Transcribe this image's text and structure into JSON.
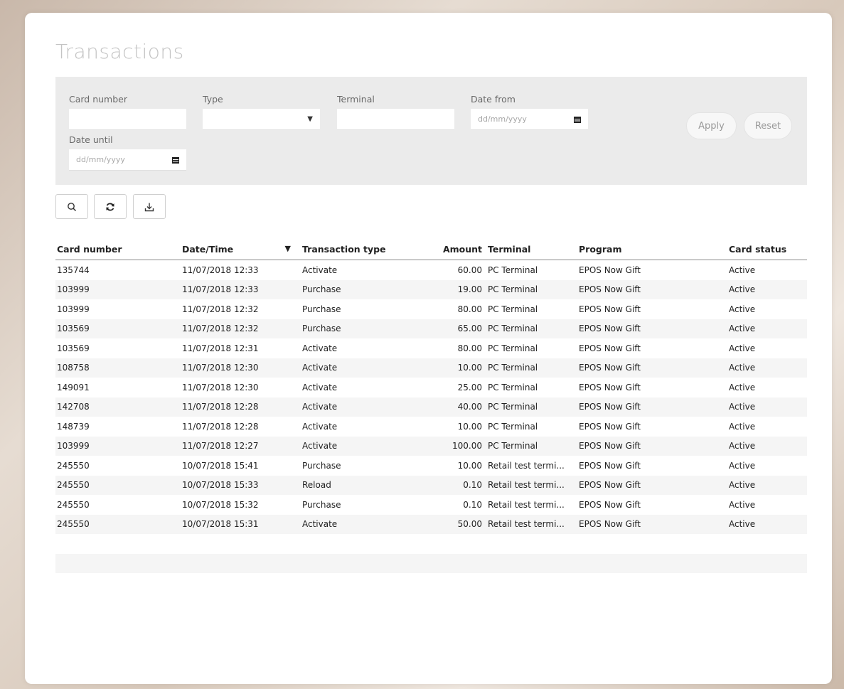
{
  "page": {
    "title": "Transactions"
  },
  "filters": {
    "card_number_label": "Card number",
    "type_label": "Type",
    "terminal_label": "Terminal",
    "date_from_label": "Date from",
    "date_from_placeholder": "dd/mm/yyyy",
    "date_until_label": "Date until",
    "date_until_placeholder": "dd/mm/yyyy",
    "apply_label": "Apply",
    "reset_label": "Reset"
  },
  "table": {
    "columns": [
      "Card number",
      "Date/Time",
      "Transaction type",
      "Amount",
      "Terminal",
      "Program",
      "Card status"
    ],
    "rows": [
      [
        "135744",
        "11/07/2018 12:33",
        "Activate",
        "60.00",
        "PC Terminal",
        "EPOS Now Gift",
        "Active"
      ],
      [
        "103999",
        "11/07/2018 12:33",
        "Purchase",
        "19.00",
        "PC Terminal",
        "EPOS Now Gift",
        "Active"
      ],
      [
        "103999",
        "11/07/2018 12:32",
        "Purchase",
        "80.00",
        "PC Terminal",
        "EPOS Now Gift",
        "Active"
      ],
      [
        "103569",
        "11/07/2018 12:32",
        "Purchase",
        "65.00",
        "PC Terminal",
        "EPOS Now Gift",
        "Active"
      ],
      [
        "103569",
        "11/07/2018 12:31",
        "Activate",
        "80.00",
        "PC Terminal",
        "EPOS Now Gift",
        "Active"
      ],
      [
        "108758",
        "11/07/2018 12:30",
        "Activate",
        "10.00",
        "PC Terminal",
        "EPOS Now Gift",
        "Active"
      ],
      [
        "149091",
        "11/07/2018 12:30",
        "Activate",
        "25.00",
        "PC Terminal",
        "EPOS Now Gift",
        "Active"
      ],
      [
        "142708",
        "11/07/2018 12:28",
        "Activate",
        "40.00",
        "PC Terminal",
        "EPOS Now Gift",
        "Active"
      ],
      [
        "148739",
        "11/07/2018 12:28",
        "Activate",
        "10.00",
        "PC Terminal",
        "EPOS Now Gift",
        "Active"
      ],
      [
        "103999",
        "11/07/2018 12:27",
        "Activate",
        "100.00",
        "PC Terminal",
        "EPOS Now Gift",
        "Active"
      ],
      [
        "245550",
        "10/07/2018 15:41",
        "Purchase",
        "10.00",
        "Retail test termi...",
        "EPOS Now Gift",
        "Active"
      ],
      [
        "245550",
        "10/07/2018 15:33",
        "Reload",
        "0.10",
        "Retail test termi...",
        "EPOS Now Gift",
        "Active"
      ],
      [
        "245550",
        "10/07/2018 15:32",
        "Purchase",
        "0.10",
        "Retail test termi...",
        "EPOS Now Gift",
        "Active"
      ],
      [
        "245550",
        "10/07/2018 15:31",
        "Activate",
        "50.00",
        "Retail test termi...",
        "EPOS Now Gift",
        "Active"
      ]
    ]
  },
  "icons": {
    "search": "search-icon",
    "refresh": "refresh-icon",
    "download": "download-icon",
    "calendar": "calendar-icon",
    "select": "caret-down-icon",
    "sort": "sort-desc-icon"
  }
}
